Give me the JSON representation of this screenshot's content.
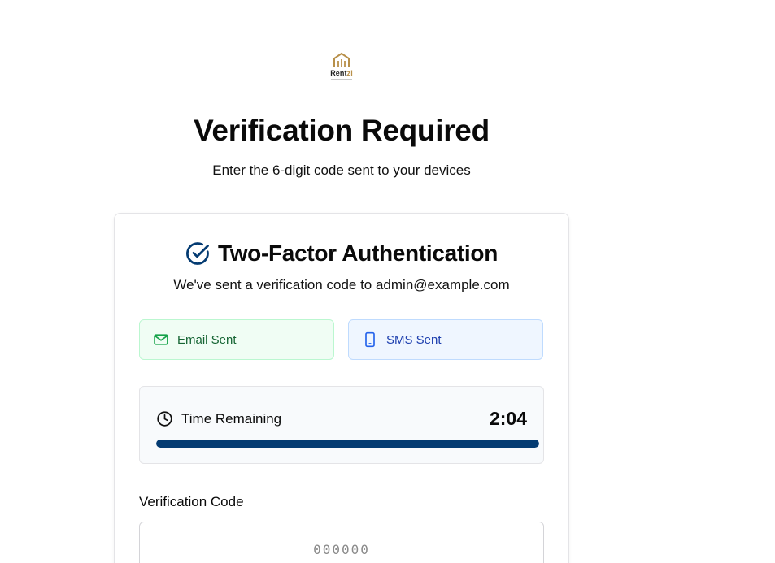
{
  "brand": {
    "name_main": "Rent",
    "name_accent": "zi",
    "accent_color": "#b8904a"
  },
  "header": {
    "title": "Verification Required",
    "subtitle": "Enter the 6-digit code sent to your devices"
  },
  "card": {
    "title": "Two-Factor Authentication",
    "title_icon": "check-circle-icon",
    "description": "We've sent a verification code to admin@example.com"
  },
  "status": {
    "email": {
      "label": "Email Sent",
      "icon": "mail-icon",
      "color": "#166534"
    },
    "sms": {
      "label": "SMS Sent",
      "icon": "smartphone-icon",
      "color": "#1e40af"
    }
  },
  "timer": {
    "label": "Time Remaining",
    "value": "2:04",
    "icon": "clock-icon",
    "progress_fraction": 1.0,
    "bar_color": "#043b72"
  },
  "verification": {
    "label": "Verification Code",
    "placeholder": "000000",
    "value": ""
  }
}
